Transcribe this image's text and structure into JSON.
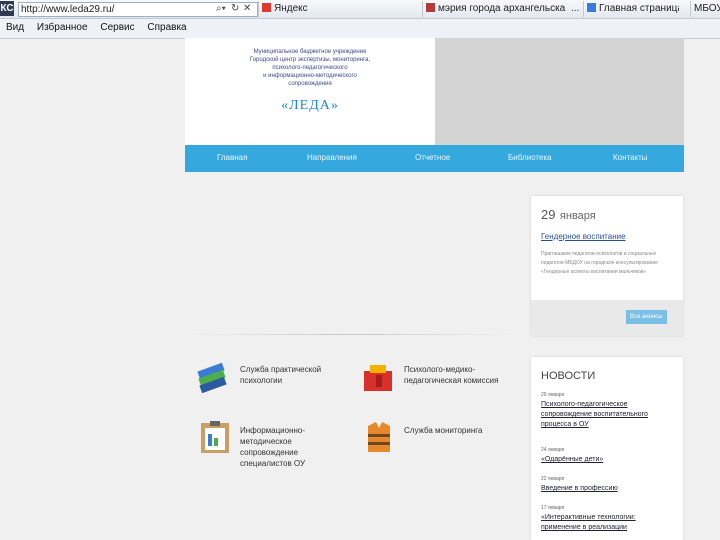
{
  "browser": {
    "ks_label": "КС",
    "url": "http://www.leda29.ru/",
    "tabs": [
      {
        "label": "Яндекс"
      },
      {
        "label": "мэрия города архангельска"
      },
      {
        "label": "..."
      },
      {
        "label": "Главная страница"
      },
      {
        "label": "МБОУ"
      }
    ],
    "menu": [
      "Вид",
      "Избранное",
      "Сервис",
      "Справка"
    ]
  },
  "logo": {
    "line1": "Муниципальное бюджетное учреждение",
    "line2": "Городской центр экспертизы, мониторинга,",
    "line3": "психолого-педагогического",
    "line4": "и информационно-методического",
    "line5": "сопровождения",
    "name": "«ЛЕДА»"
  },
  "nav": [
    "Главная",
    "Направления",
    "Отчетное",
    "Библиотека",
    "Контакты"
  ],
  "event_panel": {
    "date_day": "29",
    "date_month": "января",
    "title": "Гендерное воспитание",
    "text": "Приглашаем педагогов-психологов и социальных педагогов МБДОУ на городское консультирование «Гендерные аспекты воспитания мальчиков»",
    "button": "Все анонсы"
  },
  "services": [
    {
      "label": "Служба практической психологии"
    },
    {
      "label": "Психолого-медико-педагогическая комиссия"
    },
    {
      "label": "Информационно-методическое сопровождение специалистов ОУ"
    },
    {
      "label": "Служба мониторинга"
    }
  ],
  "news": {
    "title": "НОВОСТИ",
    "items": [
      {
        "date": "29 января",
        "text": "Психолого-педагогическое сопровождение воспитательного процесса в ОУ"
      },
      {
        "date": "24 января",
        "text": "«Одарённые дети»"
      },
      {
        "date": "22 января",
        "text": "Введение в профессию"
      },
      {
        "date": "17 января",
        "text": "«Интерактивные технологии: применение в реализации"
      }
    ]
  },
  "colors": {
    "nav": "#35a8dd",
    "button": "#79bfe6"
  }
}
